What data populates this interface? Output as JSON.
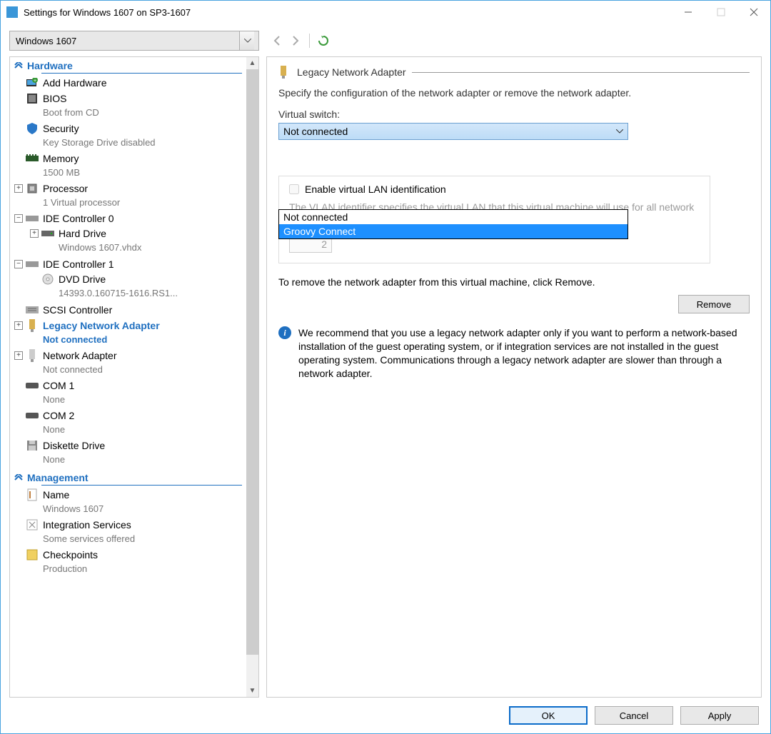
{
  "titlebar": {
    "text": "Settings for Windows 1607 on SP3-1607"
  },
  "vm_selector": {
    "value": "Windows 1607"
  },
  "categories": {
    "hardware": "Hardware",
    "management": "Management"
  },
  "tree": {
    "add_hardware": "Add Hardware",
    "bios": {
      "label": "BIOS",
      "sub": "Boot from CD"
    },
    "security": {
      "label": "Security",
      "sub": "Key Storage Drive disabled"
    },
    "memory": {
      "label": "Memory",
      "sub": "1500 MB"
    },
    "processor": {
      "label": "Processor",
      "sub": "1 Virtual processor"
    },
    "ide0": {
      "label": "IDE Controller 0"
    },
    "hard_drive": {
      "label": "Hard Drive",
      "sub": "Windows 1607.vhdx"
    },
    "ide1": {
      "label": "IDE Controller 1"
    },
    "dvd": {
      "label": "DVD Drive",
      "sub": "14393.0.160715-1616.RS1..."
    },
    "scsi": {
      "label": "SCSI Controller"
    },
    "legacy": {
      "label": "Legacy Network Adapter",
      "sub": "Not connected"
    },
    "netadapter": {
      "label": "Network Adapter",
      "sub": "Not connected"
    },
    "com1": {
      "label": "COM 1",
      "sub": "None"
    },
    "com2": {
      "label": "COM 2",
      "sub": "None"
    },
    "diskette": {
      "label": "Diskette Drive",
      "sub": "None"
    },
    "name": {
      "label": "Name",
      "sub": "Windows 1607"
    },
    "integration": {
      "label": "Integration Services",
      "sub": "Some services offered"
    },
    "checkpoints": {
      "label": "Checkpoints",
      "sub": "Production"
    }
  },
  "panel": {
    "title": "Legacy Network Adapter",
    "desc": "Specify the configuration of the network adapter or remove the network adapter.",
    "vswitch_label": "Virtual switch:",
    "vswitch_value": "Not connected",
    "dropdown": {
      "opt1": "Not connected",
      "opt2": "Groovy Connect"
    },
    "vlan_enable": "Enable virtual LAN identification",
    "vlan_desc": "The VLAN identifier specifies the virtual LAN that this virtual machine will use for all network communications through this network adapter.",
    "vlan_id": "2",
    "remove_text": "To remove the network adapter from this virtual machine, click Remove.",
    "remove_btn": "Remove",
    "info": "We recommend that you use a legacy network adapter only if you want to perform a network-based installation of the guest operating system, or if integration services are not installed in the guest operating system. Communications through a legacy network adapter are slower than through a network adapter."
  },
  "footer": {
    "ok": "OK",
    "cancel": "Cancel",
    "apply": "Apply"
  }
}
